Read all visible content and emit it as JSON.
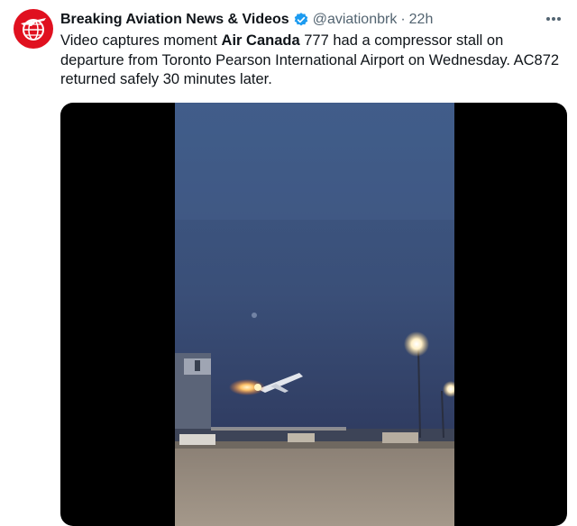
{
  "author": {
    "name": "Breaking Aviation News & Videos",
    "handle": "@aviationbrk",
    "time": "22h",
    "avatar_color": "#e0101f",
    "verified_color": "#1d9bf0"
  },
  "tweet": {
    "text_before": "Video captures moment ",
    "text_bold": "Air Canada",
    "text_after": " 777 had a compressor stall on departure from Toronto Pearson International Airport on Wednesday. AC872 returned safely 30 minutes later."
  },
  "icons": {
    "more": "more-horizontal-icon",
    "verified": "verified-badge-icon",
    "avatar": "airplane-globe-logo"
  },
  "media": {
    "type": "video"
  }
}
